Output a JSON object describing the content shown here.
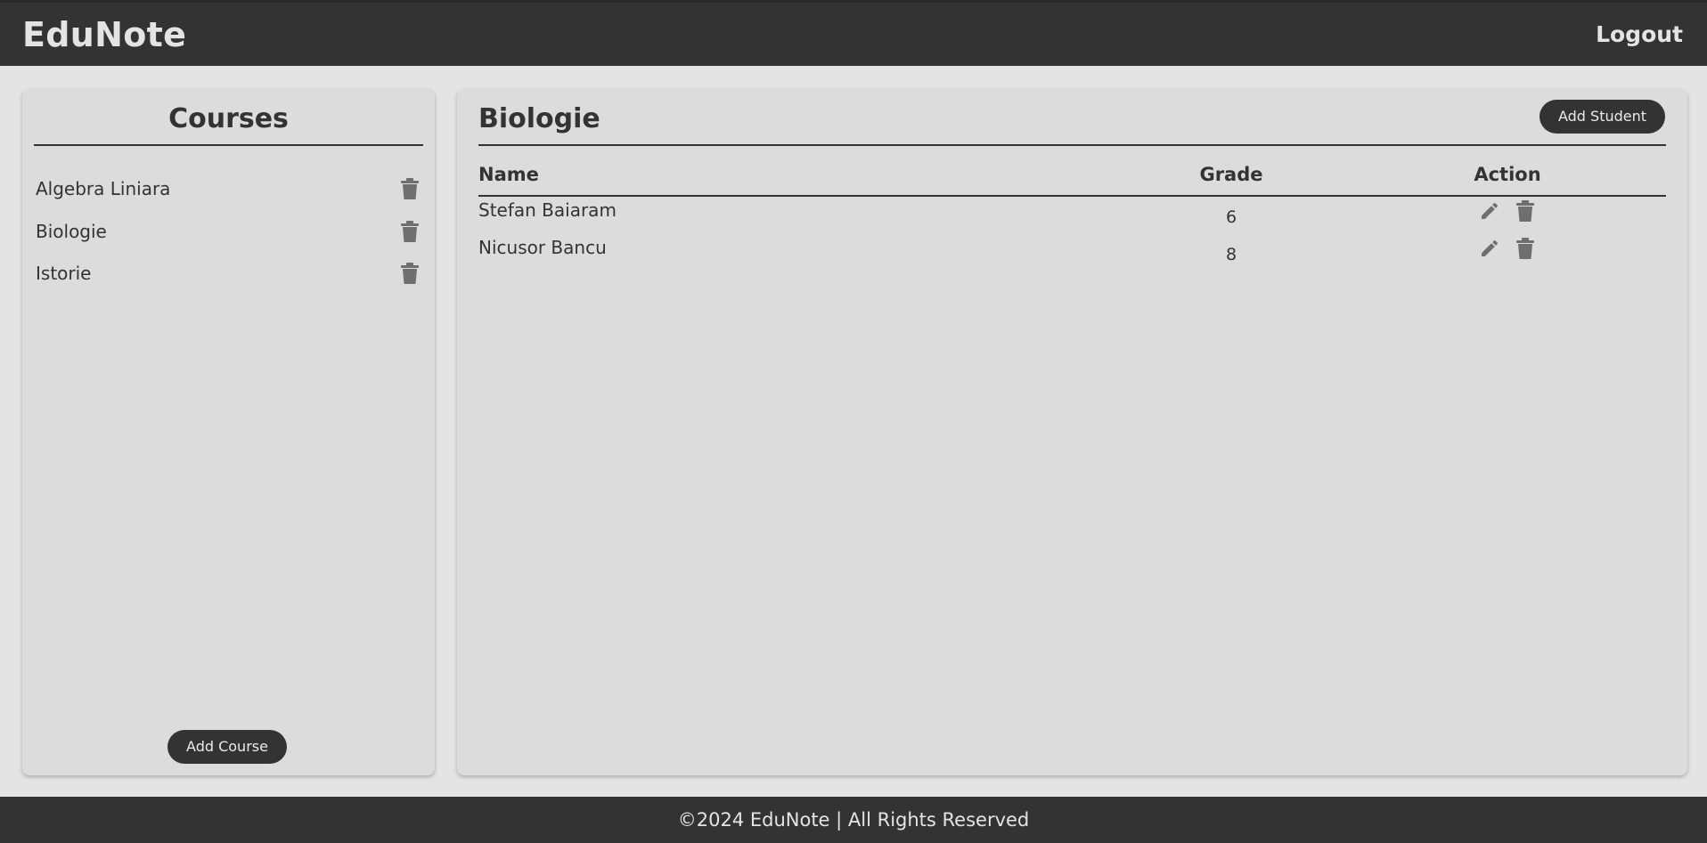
{
  "header": {
    "brand": "EduNote",
    "logout_label": "Logout"
  },
  "courses_panel": {
    "title": "Courses",
    "items": [
      {
        "label": "Algebra Liniara",
        "icon": "trash-icon"
      },
      {
        "label": "Biologie",
        "icon": "trash-icon"
      },
      {
        "label": "Istorie",
        "icon": "trash-icon"
      }
    ],
    "add_course_label": "Add Course"
  },
  "course_detail": {
    "title": "Biologie",
    "add_student_label": "Add Student",
    "columns": [
      "Name",
      "Grade",
      "Action"
    ],
    "students": [
      {
        "name": "Stefan Baiaram",
        "grade": "6",
        "actions": [
          "edit-icon",
          "trash-icon"
        ]
      },
      {
        "name": "Nicusor Bancu",
        "grade": "8",
        "actions": [
          "edit-icon",
          "trash-icon"
        ]
      }
    ]
  },
  "footer": {
    "text": "©2024 EduNote | All Rights Reserved"
  },
  "colors": {
    "dark": "#333333",
    "page_bg": "#e4e4e4",
    "panel_bg": "#dcdcdc",
    "icon_gray": "#6f6f6f"
  }
}
